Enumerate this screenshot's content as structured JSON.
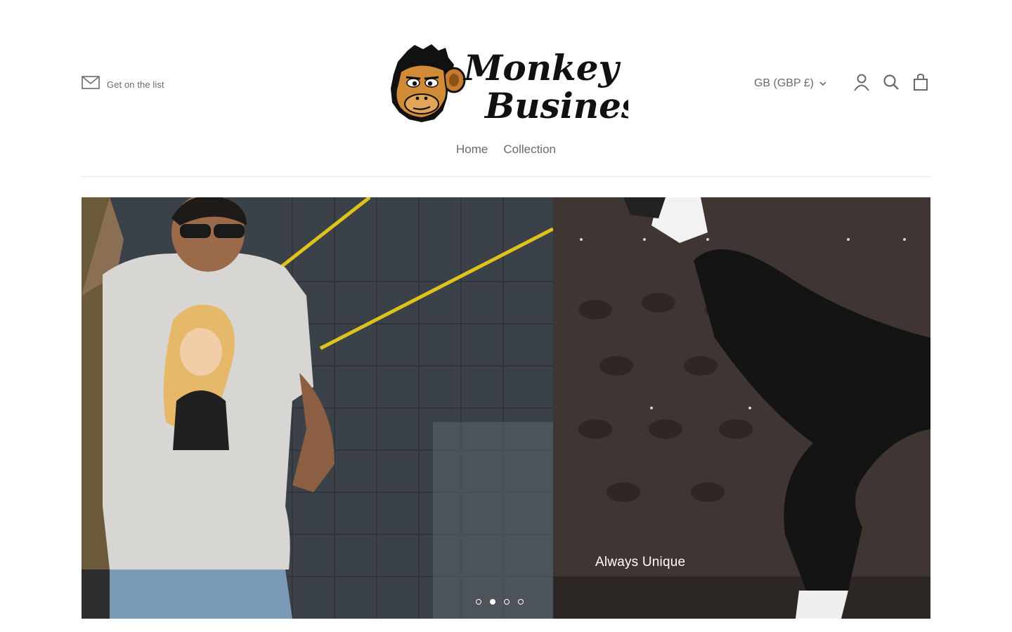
{
  "header": {
    "newsletter_label": "Get on the list",
    "logo_text_line1": "Monkey",
    "logo_text_line2": "Business",
    "currency": "GB (GBP £)"
  },
  "nav": {
    "items": [
      {
        "label": "Home"
      },
      {
        "label": "Collection"
      }
    ]
  },
  "hero": {
    "caption": "Always Unique",
    "slides_count": 4,
    "active_slide": 2
  },
  "icons": {
    "newsletter": "envelope-icon",
    "account": "user-icon",
    "search": "search-icon",
    "cart": "shopping-bag-icon",
    "currency_dropdown": "chevron-down-icon"
  },
  "colors": {
    "text": "#6a6a6a",
    "divider": "#e6e6e6",
    "caption": "#ffffff"
  }
}
